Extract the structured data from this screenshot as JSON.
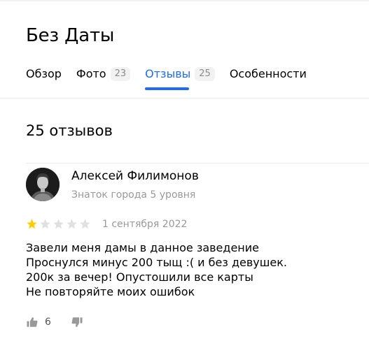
{
  "page": {
    "title": "Без Даты"
  },
  "tabs": [
    {
      "label": "Обзор",
      "count": ""
    },
    {
      "label": "Фото",
      "count": "23"
    },
    {
      "label": "Отзывы",
      "count": "25"
    },
    {
      "label": "Особенности",
      "count": ""
    }
  ],
  "reviews": {
    "count_label": "25 отзывов",
    "items": [
      {
        "author": "Алексей Филимонов",
        "level": "Знаток города 5 уровня",
        "rating": 1,
        "rating_max": 5,
        "date": "1 сентября 2022",
        "lines": [
          "Завели меня дамы в данное заведение",
          "Проснулся минус 200 тыщ :( и без девушек.",
          "200к за вечер! Опустошили все карты",
          "Не повторяйте моих ошибок"
        ],
        "likes": "6"
      }
    ]
  },
  "colors": {
    "accent": "#1e6aff",
    "star_filled": "#fc0",
    "star_empty": "#e0e0e0",
    "muted": "#999999"
  }
}
